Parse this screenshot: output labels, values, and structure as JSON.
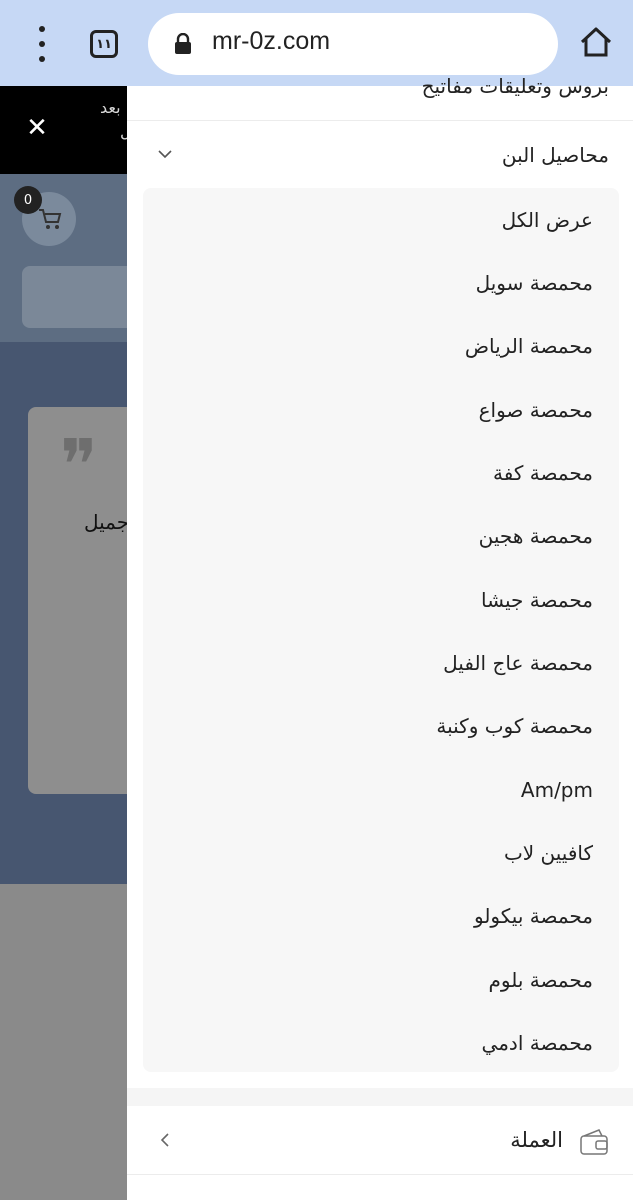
{
  "browser": {
    "url": "mr-0z.com",
    "tab_count": "١١"
  },
  "background": {
    "topstrip_line1": "بعد",
    "topstrip_line2": "ل",
    "cart_count": "0",
    "card_text": "جميل"
  },
  "drawer": {
    "top_partial_label": "بروس وتعليقات مفاتيح",
    "section_label": "محاصيل البن",
    "submenu_items": [
      "عرض الكل",
      "محمصة سويل",
      "محمصة الرياض",
      "محمصة صواع",
      "محمصة كفة",
      "محمصة هجين",
      "محمصة جيشا",
      "محمصة عاج الفيل",
      "محمصة كوب وكنبة",
      "Am/pm",
      "كافيين لاب",
      "محمصة بيكولو",
      "محمصة بلوم",
      "محمصة ادمي"
    ],
    "currency_label": "العملة"
  }
}
